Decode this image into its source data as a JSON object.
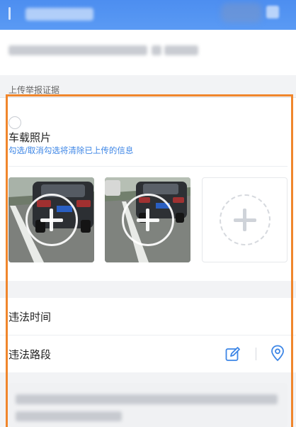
{
  "section": {
    "label": "上传举报证据"
  },
  "photo_card": {
    "title": "车载照片",
    "hint": "勾选/取消勾选将清除已上传的信息"
  },
  "form_rows": [
    {
      "label": "违法时间"
    },
    {
      "label": "违法路段"
    }
  ],
  "icons": {
    "edit": "edit-icon",
    "location": "map-pin-icon",
    "add": "plus-icon"
  },
  "colors": {
    "header": "#4d8ef0",
    "hint_text": "#3d86e6",
    "highlight_frame": "#f0862c"
  }
}
